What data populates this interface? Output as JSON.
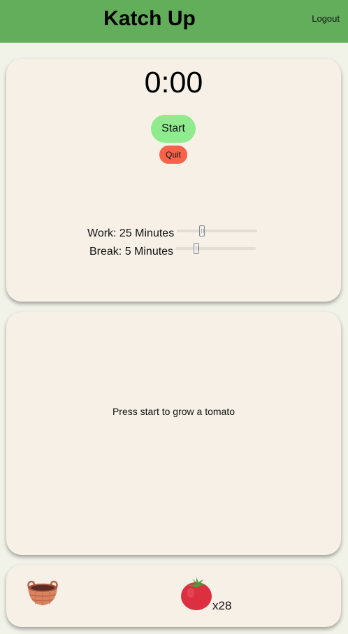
{
  "header": {
    "title": "Katch Up",
    "logout_label": "Logout",
    "bg_color": "#62ae5b"
  },
  "timer": {
    "display": "0:00",
    "start_label": "Start",
    "quit_label": "Quit",
    "start_color": "#90ea8e",
    "quit_color": "#f6624a"
  },
  "sliders": {
    "work": {
      "label": "Work: 25 Minutes",
      "value": 25,
      "unit": "Minutes"
    },
    "break": {
      "label": "Break: 5 Minutes",
      "value": 5,
      "unit": "Minutes"
    }
  },
  "tomato_panel": {
    "message": "Press start to grow a tomato"
  },
  "inventory": {
    "basket_icon": "basket-icon",
    "tomato_icon": "tomato-icon",
    "tomato_count": "x28"
  }
}
